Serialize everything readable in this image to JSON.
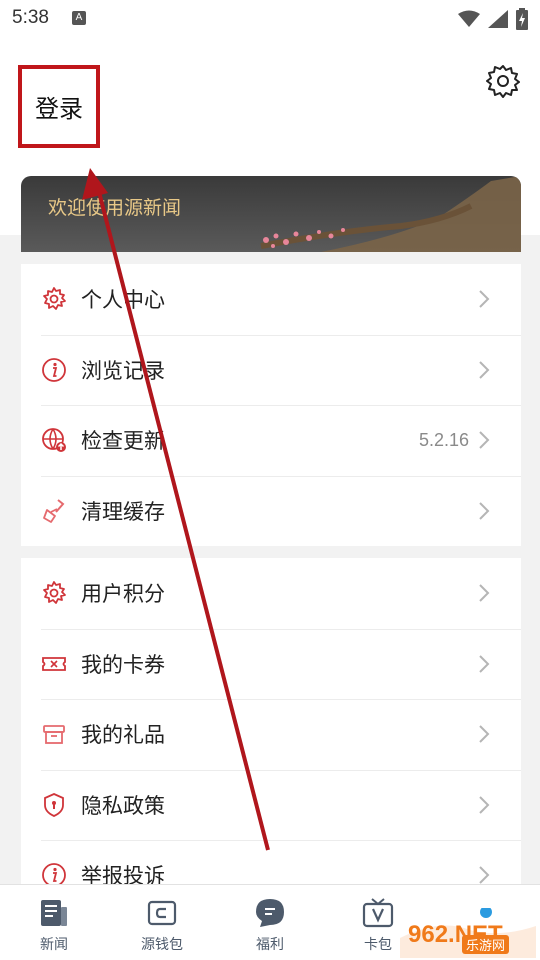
{
  "status_bar": {
    "time": "5:38",
    "notification_badge": "A"
  },
  "header": {
    "login_label": "登录",
    "settings_icon": "gear-icon"
  },
  "banner": {
    "welcome_text": "欢迎使用源新闻"
  },
  "menu_group_1": {
    "items": [
      {
        "label": "个人中心",
        "icon": "gear-icon",
        "value": ""
      },
      {
        "label": "浏览记录",
        "icon": "info-icon",
        "value": ""
      },
      {
        "label": "检查更新",
        "icon": "globe-update-icon",
        "value": "5.2.16"
      },
      {
        "label": "清理缓存",
        "icon": "broom-icon",
        "value": ""
      }
    ]
  },
  "menu_group_2": {
    "items": [
      {
        "label": "用户积分",
        "icon": "gear-icon",
        "value": ""
      },
      {
        "label": "我的卡券",
        "icon": "ticket-icon",
        "value": ""
      },
      {
        "label": "我的礼品",
        "icon": "gift-box-icon",
        "value": ""
      },
      {
        "label": "隐私政策",
        "icon": "shield-icon",
        "value": ""
      },
      {
        "label": "举报投诉",
        "icon": "info-icon",
        "value": ""
      }
    ]
  },
  "bottom_nav": {
    "items": [
      {
        "label": "新闻",
        "icon": "news-icon"
      },
      {
        "label": "源钱包",
        "icon": "wallet-icon"
      },
      {
        "label": "福利",
        "icon": "chat-bubble-icon"
      },
      {
        "label": "卡包",
        "icon": "card-tv-icon"
      }
    ]
  },
  "watermark": {
    "text": "962.NET",
    "subtext": "乐游网"
  },
  "colors": {
    "accent_red": "#c0161a",
    "icon_red": "#d0353a",
    "nav_blue": "#4d5a6b",
    "banner_gold": "#e8c887"
  }
}
